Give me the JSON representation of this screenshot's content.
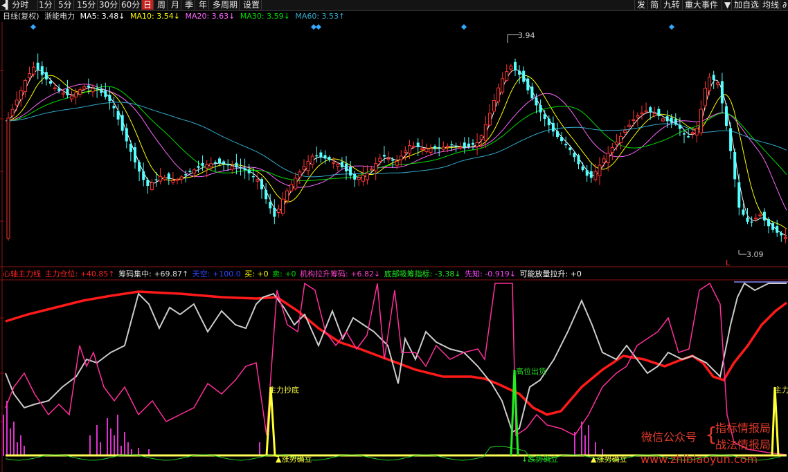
{
  "toolbar": {
    "left": [
      "分时",
      "1分",
      "5分",
      "15分",
      "30分",
      "60分",
      "日",
      "周",
      "月",
      "季",
      "年",
      "多周期",
      "设置"
    ],
    "active": "日",
    "right": [
      "发",
      "简",
      "九转",
      "重大事件",
      "▼",
      "加自选",
      "均线",
      "∂"
    ]
  },
  "legend": {
    "period": "日线(复权)",
    "stock": "浙能电力",
    "ma5": "MA5: 3.48↓",
    "ma10": "MA10: 3.54↓",
    "ma20": "MA20: 3.63↓",
    "ma30": "MA30: 3.59↓",
    "ma60": "MA60: 3.53↑"
  },
  "price_labels": {
    "high": "3.94",
    "low": "3.09",
    "l_marker": "L"
  },
  "indicator_legend": {
    "name": "心轴主力线",
    "main_pos": "主力仓位: +40.85↑",
    "chip_conc": "筹码集中: +69.87↑",
    "sky": "天空: +100.0",
    "buy": "买: +0",
    "sell": "卖: +0",
    "inst_pull": "机构拉升筹码: +6.82↓",
    "bottom_absorb": "底部吸筹指标: -3.38↓",
    "foreknow": "先知: -0.919↓",
    "vol_rise": "可能放量拉升: +0"
  },
  "annotations": {
    "main_bottom": "主力抄底",
    "top_escape": "高位出货",
    "rise_confirm_1": "▲涨势确立",
    "fall_confirm": "↓跌势确立",
    "rise_confirm_2": "▲涨势确立",
    "main_edge": "主力"
  },
  "watermark": {
    "wechat": "微信公众号",
    "brace": "{",
    "line1": "指标情报局",
    "line2": "战法情报局",
    "site": "www.zhibiaoyun.com"
  },
  "colors": {
    "up": "#ff3333",
    "down": "#54ffff",
    "ma5": "#ffffff",
    "ma10": "#ffff00",
    "ma20": "#ff66ff",
    "ma30": "#00dd00",
    "ma60": "#33aacc",
    "main_line": "#ff1a1a",
    "chip_line": "#cccccc",
    "pink_line": "#ff2f9a"
  }
}
